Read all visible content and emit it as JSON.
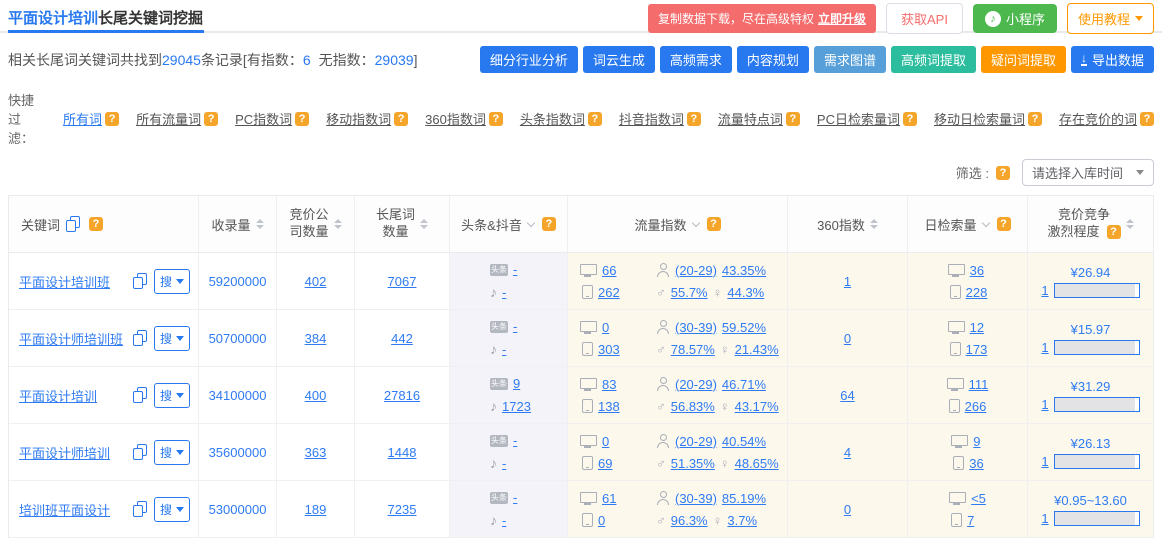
{
  "title": {
    "highlight": "平面设计培训",
    "rest": "长尾关键词挖掘"
  },
  "topbar": {
    "promo_text": "复制数据下载，尽在高级特权",
    "promo_link": "立即升级",
    "api_button": "获取API",
    "miniprogram": "小程序",
    "tutorial": "使用教程"
  },
  "summary": {
    "part1": "相关长尾词关键词共找到",
    "count": "29045",
    "part2": "条记录[有指数：",
    "with_index": "6",
    "part3": "无指数：",
    "without_index": "29039",
    "part4": "]"
  },
  "actions": [
    {
      "label": "细分行业分析",
      "cls": "blue",
      "color": "#2879f0"
    },
    {
      "label": "词云生成",
      "cls": "blue",
      "color": "#2879f0"
    },
    {
      "label": "高频需求",
      "cls": "blue",
      "color": "#2879f0"
    },
    {
      "label": "内容规划",
      "cls": "blue",
      "color": "#2879f0"
    },
    {
      "label": "需求图谱",
      "cls": "slate",
      "color": "#569fd8"
    },
    {
      "label": "高频词提取",
      "cls": "teal",
      "color": "#2bbd9e"
    },
    {
      "label": "疑问词提取",
      "cls": "orange",
      "color": "#ff9800"
    },
    {
      "label": "导出数据",
      "cls": "blue",
      "color": "#2879f0",
      "icon": "download"
    }
  ],
  "filters": {
    "label": "快捷过滤：",
    "items": [
      {
        "label": "所有词",
        "active": true
      },
      {
        "label": "所有流量词"
      },
      {
        "label": "PC指数词"
      },
      {
        "label": "移动指数词"
      },
      {
        "label": "360指数词"
      },
      {
        "label": "头条指数词"
      },
      {
        "label": "抖音指数词"
      },
      {
        "label": "流量特点词"
      },
      {
        "label": "PC日检索量词"
      },
      {
        "label": "移动日检索量词"
      },
      {
        "label": "存在竞价的词"
      }
    ]
  },
  "screen": {
    "label": "筛选 :",
    "dropdown": "请选择入库时间"
  },
  "controls": {
    "help": "?",
    "search": "搜",
    "toutiao": "头条",
    "douyin": "♪",
    "male": "♂",
    "female": "♀",
    "download_glyph": "↓",
    "miniprogram_glyph": "♪"
  },
  "table": {
    "headers": {
      "keyword": "关键词",
      "index": "收录量",
      "bidders_l1": "竞价公",
      "bidders_l2": "司数量",
      "longtail_l1": "长尾词",
      "longtail_l2": "数量",
      "toutiao": "头条&抖音",
      "flow": "流量指数",
      "idx360": "360指数",
      "daily": "日检索量",
      "bid_l1": "竞价竞争",
      "bid_l2": "激烈程度"
    },
    "rows": [
      {
        "keyword": "平面设计培训班",
        "index_count": "59200000",
        "bidders": "402",
        "longtail": "7067",
        "toutiao": "-",
        "douyin": "-",
        "flow_pc": "66",
        "flow_mobile": "262",
        "age": "(20-29)",
        "age_pct": "43.35%",
        "male_pct": "55.7%",
        "female_pct": "44.3%",
        "idx360": "1",
        "daily_pc": "36",
        "daily_mobile": "228",
        "price": "¥26.94",
        "rank": "1"
      },
      {
        "keyword": "平面设计师培训班",
        "index_count": "50700000",
        "bidders": "384",
        "longtail": "442",
        "toutiao": "-",
        "douyin": "-",
        "flow_pc": "0",
        "flow_mobile": "303",
        "age": "(30-39)",
        "age_pct": "59.52%",
        "male_pct": "78.57%",
        "female_pct": "21.43%",
        "idx360": "0",
        "daily_pc": "12",
        "daily_mobile": "173",
        "price": "¥15.97",
        "rank": "1"
      },
      {
        "keyword": "平面设计培训",
        "index_count": "34100000",
        "bidders": "400",
        "longtail": "27816",
        "toutiao": "9",
        "douyin": "1723",
        "flow_pc": "83",
        "flow_mobile": "138",
        "age": "(20-29)",
        "age_pct": "46.71%",
        "male_pct": "56.83%",
        "female_pct": "43.17%",
        "idx360": "64",
        "daily_pc": "111",
        "daily_mobile": "266",
        "price": "¥31.29",
        "rank": "1"
      },
      {
        "keyword": "平面设计师培训",
        "index_count": "35600000",
        "bidders": "363",
        "longtail": "1448",
        "toutiao": "-",
        "douyin": "-",
        "flow_pc": "0",
        "flow_mobile": "69",
        "age": "(20-29)",
        "age_pct": "40.54%",
        "male_pct": "51.35%",
        "female_pct": "48.65%",
        "idx360": "4",
        "daily_pc": "9",
        "daily_mobile": "36",
        "price": "¥26.13",
        "rank": "1"
      },
      {
        "keyword": "培训班平面设计",
        "index_count": "53000000",
        "bidders": "189",
        "longtail": "7235",
        "toutiao": "-",
        "douyin": "-",
        "flow_pc": "61",
        "flow_mobile": "0",
        "age": "(30-39)",
        "age_pct": "85.19%",
        "male_pct": "96.3%",
        "female_pct": "3.7%",
        "idx360": "0",
        "daily_pc": "<5",
        "daily_mobile": "7",
        "price": "¥0.95~13.60",
        "rank": "1"
      }
    ]
  },
  "colors": {
    "accent_blue": "#2879f0",
    "link_blue": "#2e7bf3",
    "promo_red": "#f56c6c",
    "mini_green": "#4cb84e",
    "tutorial_orange": "#ff9800",
    "badge_orange": "#f5a62a",
    "slate_blue": "#569fd8",
    "teal": "#2bbd9e",
    "col_lavender": "#f5f3fa",
    "col_cream": "#fdf8ec"
  }
}
